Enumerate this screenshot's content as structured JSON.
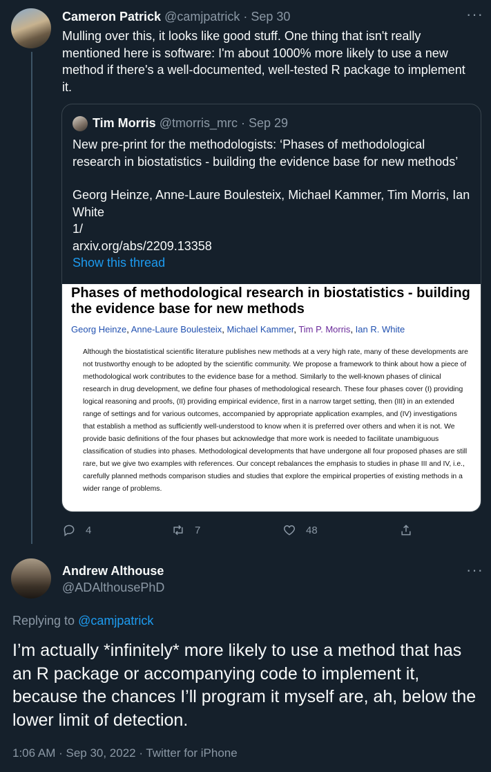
{
  "tweet": {
    "author_name": "Cameron Patrick",
    "author_handle": "@camjpatrick",
    "date": "· Sep 30",
    "more_icon": "more-horizontal-icon",
    "text": "Mulling over this, it looks like good stuff. One thing that isn't really mentioned here is software: I'm about 1000% more likely to use a new method if there's a well-documented, well-tested R package to implement it.",
    "quote": {
      "author_name": "Tim Morris",
      "author_handle": "@tmorris_mrc",
      "date": "· Sep 29",
      "line1": "New pre-print for the methodologists: ‘Phases of methodological research in biostatistics - building the evidence base for new methods’",
      "line2": "Georg Heinze, Anne-Laure Boulesteix, Michael Kammer, Tim Morris, Ian White",
      "line3": "1/",
      "line4": "arxiv.org/abs/2209.13358",
      "show_thread": "Show this thread",
      "paper": {
        "title": "Phases of methodological research in biostatistics - building the evidence base for new methods",
        "author1": "Georg Heinze",
        "author2": "Anne-Laure Boulesteix",
        "author3": "Michael Kammer",
        "author4": "Tim P. Morris",
        "author5": "Ian R. White",
        "abstract": "Although the biostatistical scientific literature publishes new methods at a very high rate, many of these developments are not trustworthy enough to be adopted by the scientific community. We propose a framework to think about how a piece of methodological work contributes to the evidence base for a method. Similarly to the well-known phases of clinical research in drug development, we define four phases of methodological research. These four phases cover (I) providing logical reasoning and proofs, (II) providing empirical evidence, first in a narrow target setting, then (III) in an extended range of settings and for various outcomes, accompanied by appropriate application examples, and (IV) investigations that establish a method as sufficiently well-understood to know when it is preferred over others and when it is not. We provide basic definitions of the four phases but acknowledge that more work is needed to facilitate unambiguous classification of studies into phases. Methodological developments that have undergone all four proposed phases are still rare, but we give two examples with references. Our concept rebalances the emphasis to studies in phase III and IV, i.e., carefully planned methods comparison studies and studies that explore the empirical properties of existing methods in a wider range of problems."
      }
    },
    "actions": {
      "replies": "4",
      "retweets": "7",
      "likes": "48",
      "icons": [
        "reply-icon",
        "retweet-icon",
        "like-icon",
        "share-icon"
      ]
    }
  },
  "reply": {
    "author_name": "Andrew Althouse",
    "author_handle": "@ADAlthousePhD",
    "replying_prefix": "Replying to",
    "replying_to": "@camjpatrick",
    "text": "I’m actually *infinitely* more likely to use a method that has an R package or accompanying code to implement it, because the chances I’ll program it myself are, ah, below the lower limit of detection.",
    "meta": "1:06 AM · Sep 30, 2022 · Twitter for iPhone"
  },
  "colors": {
    "background": "#15202b",
    "text": "#f7f9f9",
    "muted": "#8b98a5",
    "link": "#1d9bf0",
    "border": "#38444d"
  }
}
